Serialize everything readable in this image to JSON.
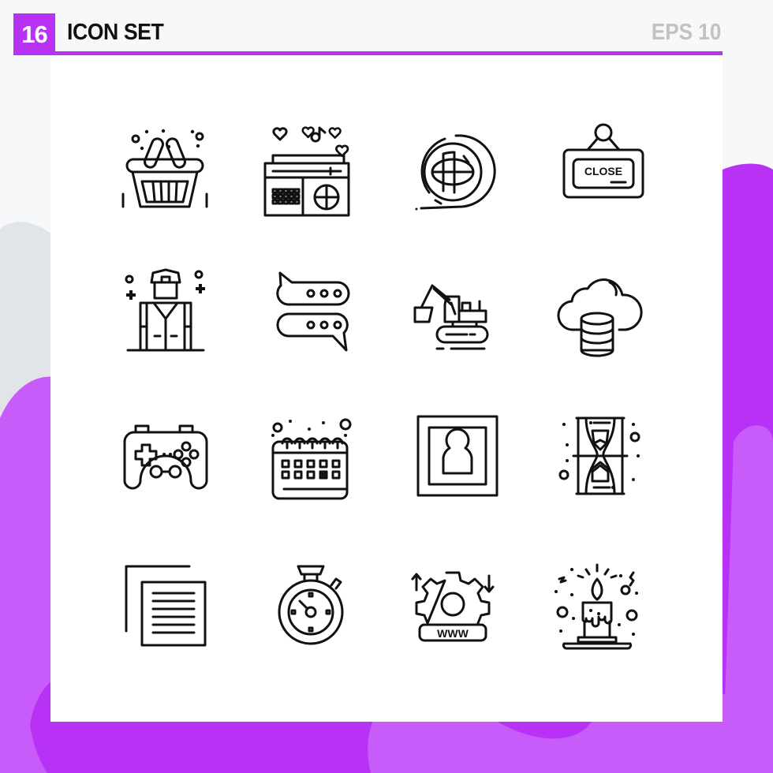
{
  "header": {
    "count_badge": "16",
    "title": "ICON SET",
    "format_label": "EPS 10"
  },
  "colors": {
    "accent": "#b832f5",
    "accent_light": "#c75cfb",
    "background": "#f7f8fa",
    "background_blob": "#e1e5ea",
    "panel": "#ffffff",
    "icon_stroke": "#111111",
    "format_label": "#c2c2c2"
  },
  "icons": [
    {
      "name": "shopping-basket-icon",
      "label": ""
    },
    {
      "name": "radio-music-icon",
      "label": ""
    },
    {
      "name": "globe-icon",
      "label": ""
    },
    {
      "name": "close-sign-icon",
      "label": "CLOSE"
    },
    {
      "name": "soldier-uniform-icon",
      "label": ""
    },
    {
      "name": "chat-bubbles-icon",
      "label": ""
    },
    {
      "name": "excavator-icon",
      "label": ""
    },
    {
      "name": "cloud-database-icon",
      "label": ""
    },
    {
      "name": "gamepad-icon",
      "label": ""
    },
    {
      "name": "calendar-icon",
      "label": ""
    },
    {
      "name": "profile-frame-icon",
      "label": ""
    },
    {
      "name": "hourglass-icon",
      "label": ""
    },
    {
      "name": "copy-document-icon",
      "label": ""
    },
    {
      "name": "stopwatch-icon",
      "label": ""
    },
    {
      "name": "web-settings-icon",
      "label": "WWW"
    },
    {
      "name": "candle-icon",
      "label": ""
    }
  ]
}
